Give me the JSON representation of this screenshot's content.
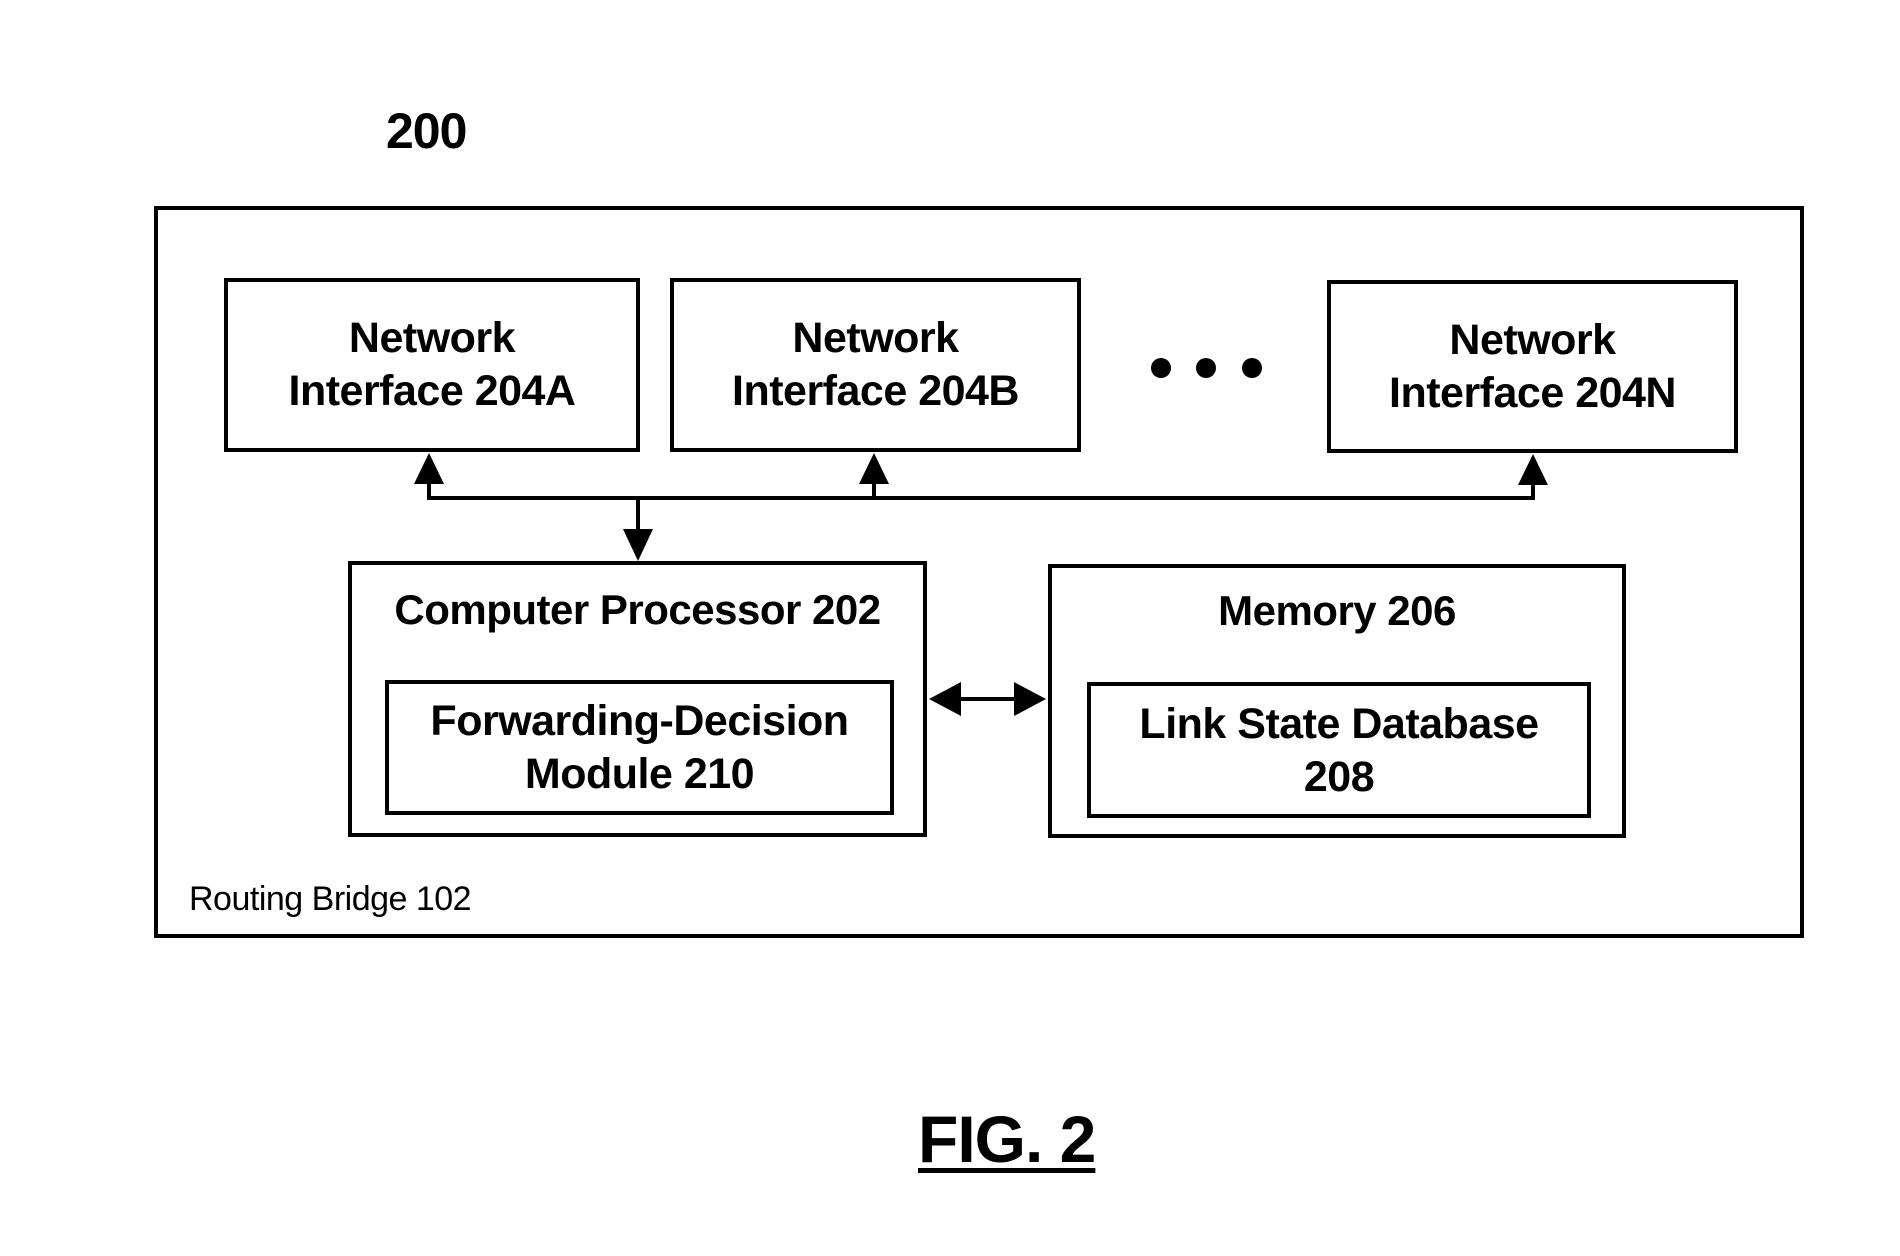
{
  "figure": {
    "number_label": "200",
    "caption": "FIG. 2",
    "container_label": "Routing Bridge 102"
  },
  "network_interfaces": [
    {
      "line1": "Network",
      "line2": "Interface 204A"
    },
    {
      "line1": "Network",
      "line2": "Interface 204B"
    },
    {
      "line1": "Network",
      "line2": "Interface 204N"
    }
  ],
  "ellipsis_icon": "three-dots",
  "processor": {
    "title": "Computer Processor 202",
    "module": {
      "line1": "Forwarding-Decision",
      "line2": "Module 210"
    }
  },
  "memory": {
    "title": "Memory 206",
    "database": {
      "line1": "Link State Database",
      "line2": "208"
    }
  },
  "connections": [
    {
      "from": "Computer Processor 202",
      "to": "Network Interface 204A",
      "type": "bus-arrow"
    },
    {
      "from": "Computer Processor 202",
      "to": "Network Interface 204B",
      "type": "bus-arrow"
    },
    {
      "from": "Computer Processor 202",
      "to": "Network Interface 204N",
      "type": "bus-arrow"
    },
    {
      "from": "Network Interface bus",
      "to": "Computer Processor 202",
      "type": "arrow"
    },
    {
      "from": "Computer Processor 202",
      "to": "Memory 206",
      "type": "bidirectional-arrow"
    }
  ]
}
